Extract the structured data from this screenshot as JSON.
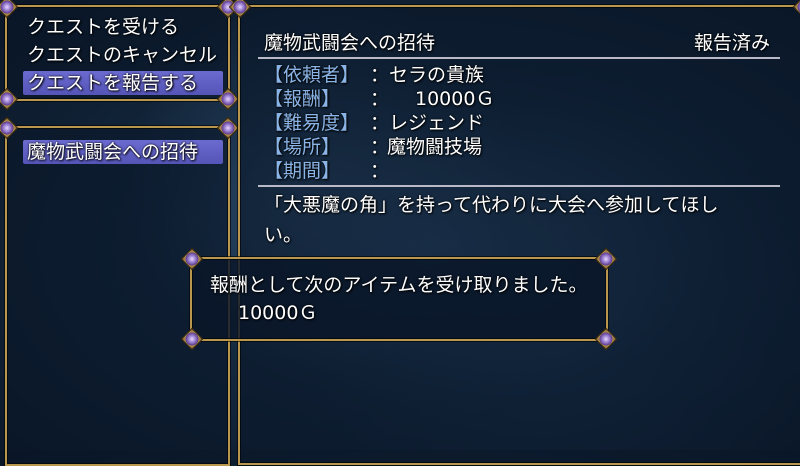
{
  "commands": {
    "accept": "クエストを受ける",
    "cancel": "クエストのキャンセル",
    "report": "クエストを報告する"
  },
  "quest_list": [
    "魔物武闘会への招待"
  ],
  "detail": {
    "title": "魔物武闘会への招待",
    "status": "報告済み",
    "client_label": "【依頼者】",
    "client_value": "：セラの貴族",
    "reward_label": "【報酬】",
    "reward_sep": "：",
    "reward_value": "10000Ｇ",
    "difficulty_label": "【難易度】",
    "difficulty_value": "：レジェンド",
    "location_label": "【場所】",
    "location_sep": "：",
    "location_value": "魔物闘技場",
    "period_label": "【期間】",
    "period_sep": "：",
    "description_line1": "「大悪魔の角」を持って代わりに大会へ参加してほし",
    "description_line2": "い。"
  },
  "message": {
    "line1": "報酬として次のアイテムを受け取りました。",
    "line2": "10000Ｇ"
  },
  "colors": {
    "frame": "#b9974e",
    "label": "#8ab4e6",
    "selection": "#6a6ad0",
    "window_bg": "#0a1628"
  }
}
